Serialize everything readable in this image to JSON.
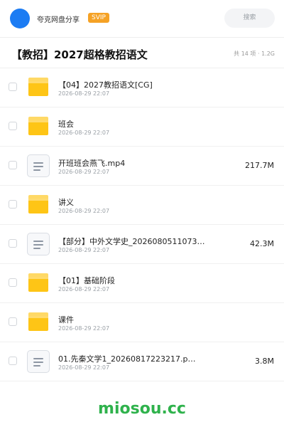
{
  "header": {
    "app_name": "夸克网盘分享",
    "badge": "SVIP",
    "search_placeholder": "搜索",
    "icons": {
      "avatar": "avatar-circle"
    }
  },
  "folder": {
    "title": "【教招】2027超格教招语文",
    "summary": "共 14 项 · 1.2G"
  },
  "items": [
    {
      "type": "folder",
      "name": "【04】2027教招语文[CG]",
      "date": "2026-08-29 22:07",
      "size": ""
    },
    {
      "type": "folder",
      "name": "班会",
      "date": "2026-08-29 22:07",
      "size": ""
    },
    {
      "type": "file",
      "name": "开班班会燕飞.mp4",
      "date": "2026-08-29 22:07",
      "size": "217.7M"
    },
    {
      "type": "folder",
      "name": "讲义",
      "date": "2026-08-29 22:07",
      "size": ""
    },
    {
      "type": "file",
      "name": "【部分】中外文学史_202608051107387…",
      "date": "2026-08-29 22:07",
      "size": "42.3M"
    },
    {
      "type": "folder",
      "name": "【01】基础阶段",
      "date": "2026-08-29 22:07",
      "size": ""
    },
    {
      "type": "folder",
      "name": "课件",
      "date": "2026-08-29 22:07",
      "size": ""
    },
    {
      "type": "file",
      "name": "01.先秦文学1_20260817223217.p…",
      "date": "2026-08-29 22:07",
      "size": "3.8M"
    }
  ],
  "watermark": "miosou.cc",
  "colors": {
    "accent": "#1c7cf3",
    "svip": "#f5a225",
    "folder": "#fec516",
    "watermark": "#2fb24c"
  }
}
